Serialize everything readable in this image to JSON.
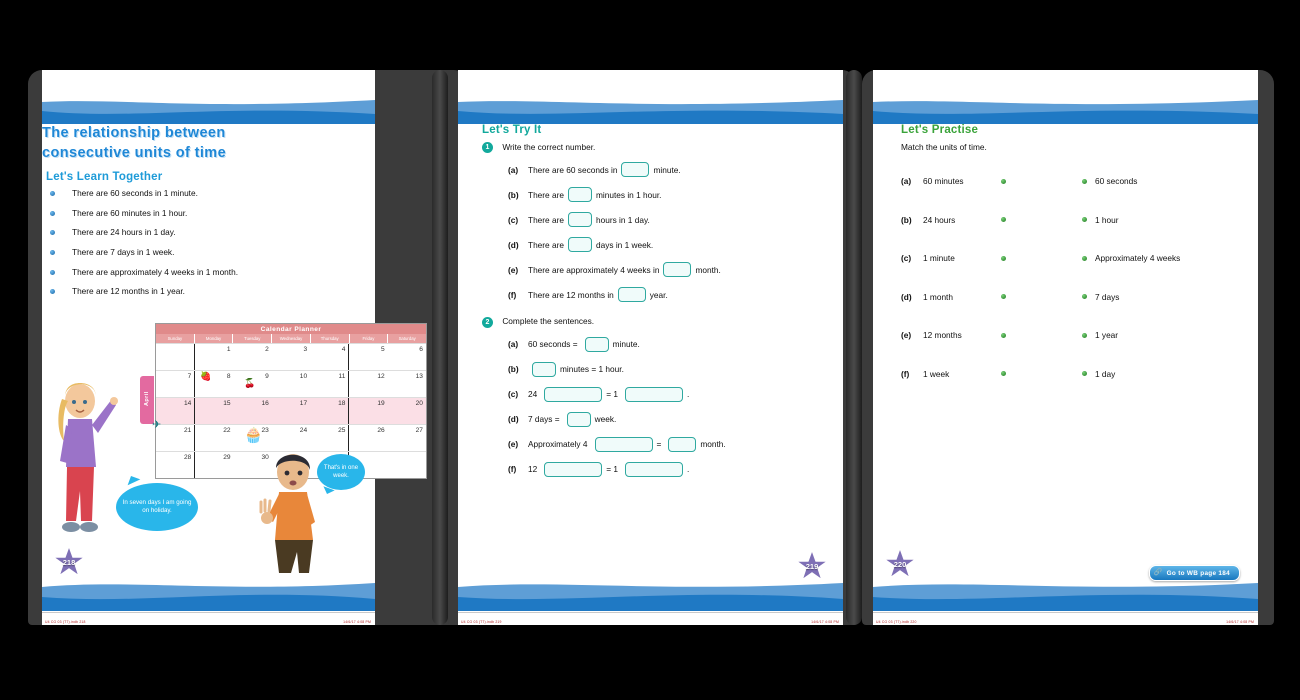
{
  "pages": [
    {
      "page_number": "218",
      "title_line1": "The relationship between",
      "title_line2": "consecutive units of time",
      "section_heading": "Let's Learn Together",
      "bullets": [
        "There are 60 seconds in 1 minute.",
        "There are 60 minutes in 1 hour.",
        "There are 24 hours in 1 day.",
        "There are 7 days in 1 week.",
        "There are approximately 4 weeks in 1 month.",
        "There are 12 months in 1 year."
      ],
      "calendar": {
        "title": "Calendar Planner",
        "month_tab": "April",
        "day_headers": [
          "Sunday",
          "Monday",
          "Tuesday",
          "Wednesday",
          "Thursday",
          "Friday",
          "Saturday"
        ],
        "weeks": [
          [
            "",
            "1",
            "2",
            "3",
            "4",
            "5",
            "6"
          ],
          [
            "7",
            "8",
            "9",
            "10",
            "11",
            "12",
            "13"
          ],
          [
            "14",
            "15",
            "16",
            "17",
            "18",
            "19",
            "20"
          ],
          [
            "21",
            "22",
            "23",
            "24",
            "25",
            "26",
            "27"
          ],
          [
            "28",
            "29",
            "30",
            "",
            "",
            "",
            ""
          ]
        ],
        "highlighted_week_index": 2
      },
      "speech_bubble_girl": "In seven days I am going on holiday.",
      "speech_bubble_boy": "That's in one week.",
      "footer_left": "U4 CG 03 (T7).indb 218",
      "footer_right": "14/6/17   4:08 PM"
    },
    {
      "page_number": "219",
      "section_heading": "Let's Try It",
      "exercise1": {
        "number": "1",
        "instruction": "Write the correct number.",
        "items": [
          {
            "label": "(a)",
            "before": "There are 60 seconds in",
            "blank_width": 26,
            "after": "minute."
          },
          {
            "label": "(b)",
            "before": "There are",
            "blank_width": 22,
            "after": "minutes in 1 hour."
          },
          {
            "label": "(c)",
            "before": "There are",
            "blank_width": 22,
            "after": "hours in 1 day."
          },
          {
            "label": "(d)",
            "before": "There are",
            "blank_width": 22,
            "after": "days in 1 week."
          },
          {
            "label": "(e)",
            "before": "There are approximately 4 weeks in",
            "blank_width": 26,
            "after": "month."
          },
          {
            "label": "(f)",
            "before": "There are 12 months in",
            "blank_width": 26,
            "after": "year."
          }
        ]
      },
      "exercise2": {
        "number": "2",
        "instruction": "Complete the sentences.",
        "items": [
          {
            "label": "(a)",
            "parts": [
              "60 seconds =",
              "B22",
              "minute."
            ]
          },
          {
            "label": "(b)",
            "parts": [
              "",
              "B22",
              "minutes = 1 hour."
            ]
          },
          {
            "label": "(c)",
            "parts": [
              "24",
              "B56",
              "= 1",
              "B56",
              "."
            ]
          },
          {
            "label": "(d)",
            "parts": [
              "7 days =",
              "B22",
              "week."
            ]
          },
          {
            "label": "(e)",
            "parts": [
              "Approximately 4",
              "B56",
              "=",
              "B26",
              "month."
            ]
          },
          {
            "label": "(f)",
            "parts": [
              "12",
              "B56",
              "= 1",
              "B56",
              "."
            ]
          }
        ]
      },
      "footer_left": "U4 CG 03 (T7).indb 219",
      "footer_right": "14/6/17   4:08 PM"
    },
    {
      "page_number": "220",
      "section_heading": "Let's Practise",
      "match_instruction": "Match the units of time.",
      "match_rows": [
        {
          "label": "(a)",
          "left": "60 minutes",
          "right": "60 seconds"
        },
        {
          "label": "(b)",
          "left": "24 hours",
          "right": "1 hour"
        },
        {
          "label": "(c)",
          "left": "1 minute",
          "right": "Approximately 4 weeks"
        },
        {
          "label": "(d)",
          "left": "1 month",
          "right": "7 days"
        },
        {
          "label": "(e)",
          "left": "12 months",
          "right": "1 year"
        },
        {
          "label": "(f)",
          "left": "1 week",
          "right": "1 day"
        }
      ],
      "wb_button_label": "Go to WB page 184",
      "footer_left": "U4 CG 03 (T7).indb 220",
      "footer_right": "14/6/17   4:08 PM"
    }
  ],
  "colors": {
    "title_blue": "#1e87d6",
    "learn_blue": "#1e9bd8",
    "try_teal": "#11a89c",
    "practise_green": "#3aa33a",
    "wave_blue": "#2a7fc0",
    "calendar_pink": "#e08a8a",
    "star_purple": "#7e6fb5",
    "bubble_blue": "#29b6ea"
  }
}
